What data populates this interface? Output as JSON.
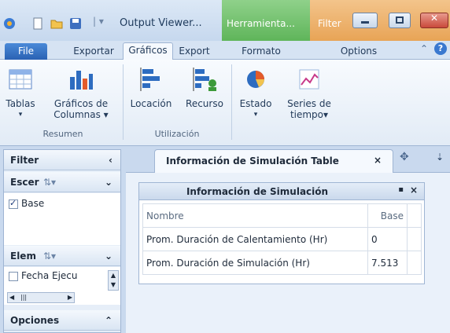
{
  "window": {
    "title": "Output Viewer...",
    "context_herramientas": "Herramienta...",
    "context_filter": "Filter"
  },
  "tabs": [
    "File",
    "Exportar",
    "Gráficos",
    "Export",
    "Formato",
    "Options"
  ],
  "ribbon": {
    "tablas": "Tablas",
    "graficos_columnas": [
      "Gráficos de",
      "Columnas"
    ],
    "locacion": "Locación",
    "recurso": "Recurso",
    "estado": "Estado",
    "series_tiempo": [
      "Series de",
      "tiempo"
    ],
    "group_resumen": "Resumen",
    "group_utilizacion": "Utilización"
  },
  "left_panel": {
    "filter_title": "Filter",
    "escenarios_label": "Escer",
    "base_item": "Base",
    "elementos_label": "Elem",
    "fecha_item": "Fecha Ejecu",
    "opciones_title": "Opciones"
  },
  "document": {
    "tab_title": "Información de Simulación Table",
    "panel_title": "Información de Simulación",
    "columns": [
      "Nombre",
      "Base"
    ],
    "rows": [
      [
        "Prom. Duración de Calentamiento (Hr)",
        "0"
      ],
      [
        "Prom. Duración de Simulación (Hr)",
        "7.513"
      ]
    ]
  }
}
